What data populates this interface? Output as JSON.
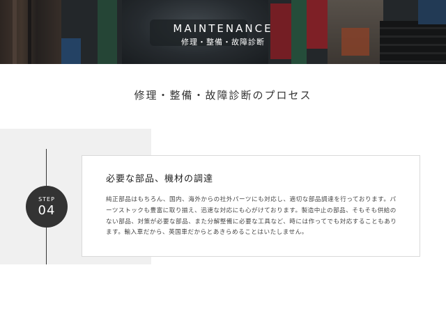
{
  "hero": {
    "title": "MAINTENANCE",
    "subtitle": "修理・整備・故障診断"
  },
  "section": {
    "title": "修理・整備・故障診断のプロセス"
  },
  "step": {
    "label": "STEP",
    "number": "04",
    "title": "必要な部品、機材の調達",
    "body": "純正部品はもちろん、国内、海外からの社外パーツにも対応し、適切な部品調達を行っております。パーツストックも豊富に取り揃え、迅速な対応にも心がけております。製造中止の部品、そもそも供給のない部品、対策が必要な部品、また分解整備に必要な工具など、時には作ってでも対応することもあります。輸入車だから、英国車だからとあきらめることはいたしません。"
  },
  "colors": {
    "accent_dark": "#333333",
    "panel_gray": "#f0f0f0",
    "card_border": "#d9d9d9"
  }
}
